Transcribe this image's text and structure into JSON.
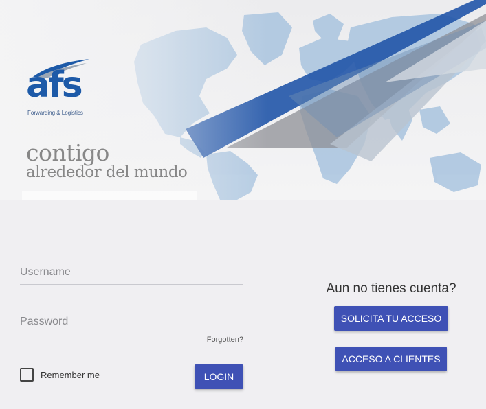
{
  "brand": {
    "logo_text": "afs",
    "logo_subtitle": "Forwarding & Logistics",
    "tagline_line1": "contigo",
    "tagline_line2": "alrededor del mundo",
    "colors": {
      "brand_blue": "#1d5aa8",
      "map_blue": "#9fbddc",
      "button": "#3f51b5"
    }
  },
  "login": {
    "username": {
      "placeholder": "Username",
      "value": ""
    },
    "password": {
      "placeholder": "Password",
      "value": ""
    },
    "forgotten_link": "Forgotten?",
    "remember_label": "Remember me",
    "remember_checked": false,
    "login_button": "LOGIN"
  },
  "signup": {
    "heading": "Aun no tienes cuenta?",
    "request_access_button": "SOLICITA TU ACCESO",
    "client_access_button": "ACCESO A CLIENTES"
  }
}
